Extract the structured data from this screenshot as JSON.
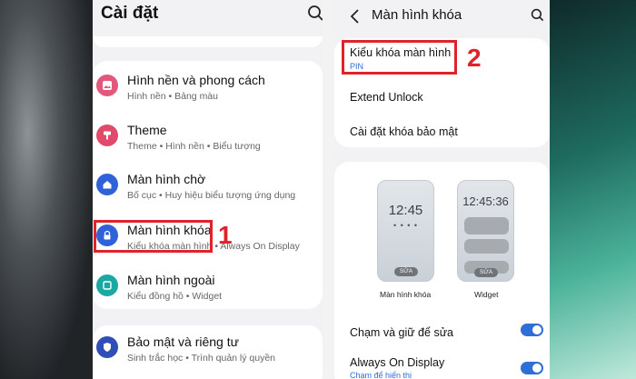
{
  "left_phone": {
    "title": "Cài đặt",
    "items": [
      {
        "title": "Hình nền và phong cách",
        "subtitle": "Hình nền • Bảng màu",
        "icon": "wallpaper-icon",
        "color": "#e4577a"
      },
      {
        "title": "Theme",
        "subtitle": "Theme • Hình nền • Biểu tượng",
        "icon": "theme-icon",
        "color": "#e04b6c"
      },
      {
        "title": "Màn hình chờ",
        "subtitle": "Bố cục • Huy hiệu biểu tượng ứng dụng",
        "icon": "home-icon",
        "color": "#2f62d8"
      },
      {
        "title": "Màn hình khóa",
        "subtitle": "Kiểu khóa màn hình • Always On Display",
        "icon": "lock-icon",
        "color": "#2f62d8"
      },
      {
        "title": "Màn hình ngoài",
        "subtitle": "Kiểu đồng hồ • Widget",
        "icon": "cover-screen-icon",
        "color": "#1aa9a2"
      },
      {
        "title": "Bảo mật và riêng tư",
        "subtitle": "Sinh trắc học • Trình quản lý quyền",
        "icon": "shield-icon",
        "color": "#2f4fb7"
      }
    ],
    "step": "1"
  },
  "right_phone": {
    "title": "Màn hình khóa",
    "lock_type_label": "Kiểu khóa màn hình",
    "lock_type_value": "PIN",
    "extend_unlock": "Extend Unlock",
    "secure_lock": "Cài đặt khóa bảo mật",
    "step": "2",
    "preview_lock": {
      "time": "12:45",
      "dots": "• • • •",
      "edit": "SỬA",
      "label": "Màn hình khóa"
    },
    "preview_widget": {
      "time": "12:45:36",
      "edit": "SỬA",
      "label": "Widget"
    },
    "touch_edit": "Chạm và giữ để sửa",
    "touch_edit_on": true,
    "aod": "Always On Display",
    "aod_sub": "Chạm để hiển thị",
    "aod_on": true
  },
  "colors": {
    "accent": "#2d6fd6",
    "highlight": "#e0222a"
  }
}
